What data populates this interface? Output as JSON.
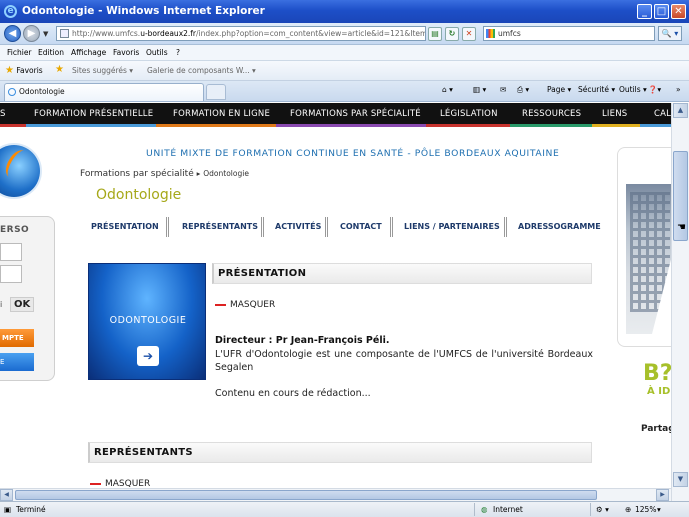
{
  "window": {
    "title": "Odontologie - Windows Internet Explorer",
    "controls": {
      "minimize": "_",
      "maximize": "□",
      "close": "✕"
    }
  },
  "address": {
    "url_prefix": "http://www.umfcs.",
    "url_domain": "u-bordeaux2.fr",
    "url_path": "/index.php?option=com_content&view=article&id=121&Itemid=122",
    "search_value": "umfcs",
    "search_button": "🔍 ▾"
  },
  "menu": {
    "items": [
      "Fichier",
      "Edition",
      "Affichage",
      "Favoris",
      "Outils",
      "?"
    ]
  },
  "favorites": {
    "favoris_label": "Favoris",
    "suggested_sites": "Sites suggérés ▾",
    "gallery": "Galerie de composants W... ▾"
  },
  "tabs": {
    "active_label": "Odontologie"
  },
  "commandbar": {
    "page": "Page ▾",
    "security": "Sécurité ▾",
    "tools": "Outils ▾",
    "help": "❓▾",
    "more": "»"
  },
  "site": {
    "topnav": [
      "S",
      "FORMATION PRÉSENTIELLE",
      "FORMATION EN LIGNE",
      "FORMATIONS PAR SPÉCIALITÉ",
      "LÉGISLATION",
      "RESSOURCES",
      "LIENS",
      "CAL"
    ],
    "topnav_colors": [
      "#c8332e",
      "#4a9ad8",
      "#e07a1a",
      "#8a4ab0",
      "#c8332e",
      "#2a9a6a",
      "#e0b020",
      "#4a9ad8"
    ],
    "header": "UNITÉ MIXTE DE FORMATION CONTINUE EN SANTÉ - PÔLE BORDEAUX AQUITAINE",
    "breadcrumb": {
      "parent": "Formations par spécialité",
      "arrow": "▸",
      "current": "Odontologie"
    },
    "page_title": "Odontologie",
    "subnav": [
      "PRÉSENTATION",
      "REPRÉSENTANTS",
      "ACTIVITÉS",
      "CONTACT",
      "LIENS / PARTENAIRES",
      "ADRESSOGRAMME"
    ],
    "login": {
      "title": "ERSO",
      "label": "i",
      "ok": "OK",
      "account_button": "MPTE",
      "blue_button": "E"
    },
    "hero": {
      "label": "ODONTOLOGIE",
      "arrow": "➔"
    },
    "section1": {
      "title": "PRÉSENTATION",
      "toggle": "MASQUER"
    },
    "director": "Directeur : Pr Jean-François Péli.",
    "paragraph": "L'UFR d'Odontologie est une composante de l'UMFCS de l'université Bordeaux Segalen",
    "under_construction": "Contenu en cours de rédaction...",
    "section2": {
      "title": "REPRÉSENTANTS",
      "toggle": "MASQUER"
    },
    "right": {
      "logo_b2": "B?",
      "logo_sub": "À ID",
      "share": "Partag"
    }
  },
  "status": {
    "text": "Terminé",
    "zone": "Internet",
    "zoom": "125%",
    "zoom_caret": "▾"
  }
}
